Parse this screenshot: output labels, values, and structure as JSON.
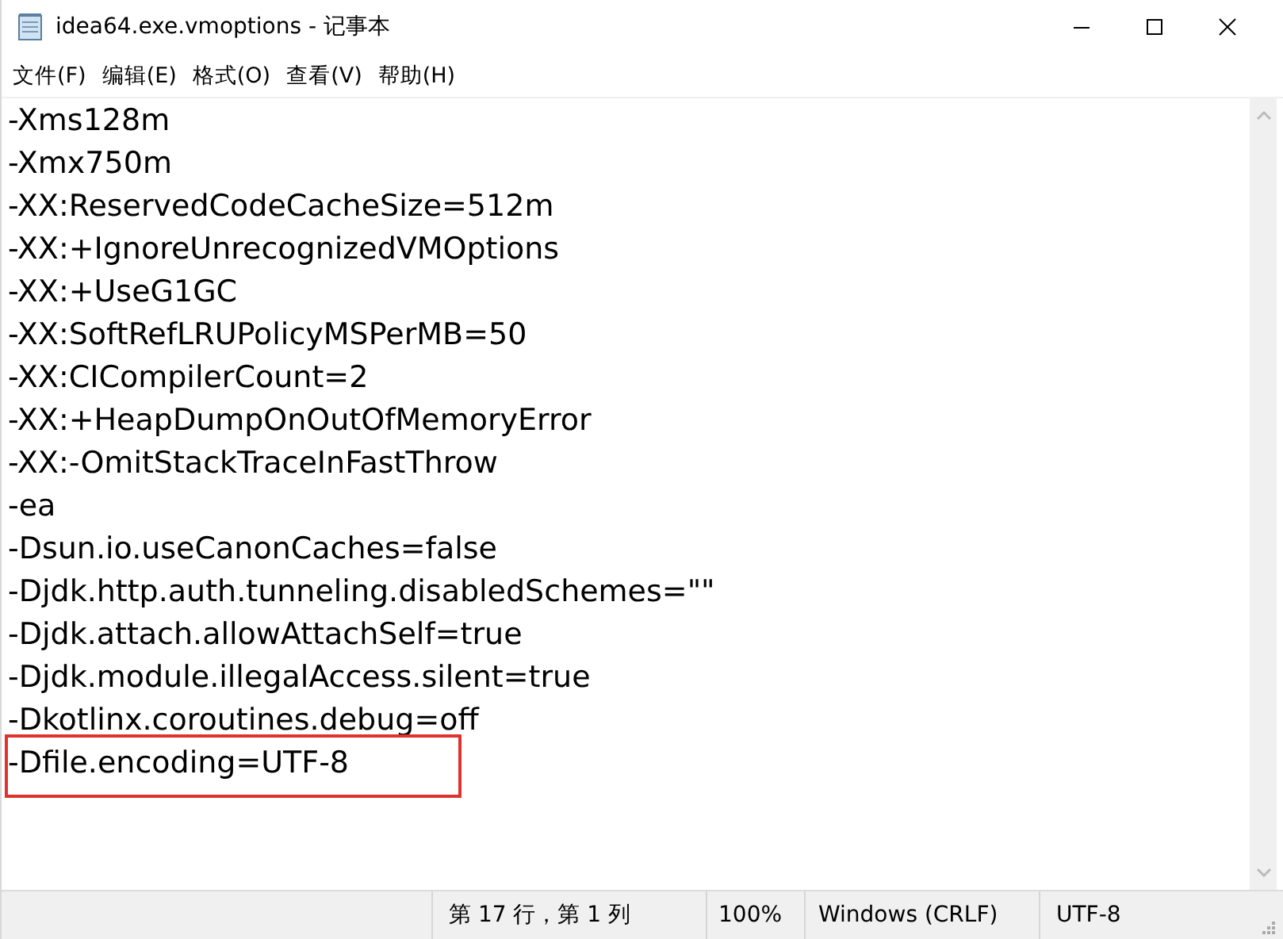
{
  "window": {
    "title": "idea64.exe.vmoptions - 记事本"
  },
  "menu": [
    "文件(F)",
    "编辑(E)",
    "格式(O)",
    "查看(V)",
    "帮助(H)"
  ],
  "lines": [
    {
      "text": "-Xms128m",
      "highlighted": false
    },
    {
      "text": "-Xmx750m",
      "highlighted": false
    },
    {
      "text": "-XX:ReservedCodeCacheSize=512m",
      "highlighted": false
    },
    {
      "text": "-XX:+IgnoreUnrecognizedVMOptions",
      "highlighted": false
    },
    {
      "text": "-XX:+UseG1GC",
      "highlighted": false
    },
    {
      "text": "-XX:SoftRefLRUPolicyMSPerMB=50",
      "highlighted": false
    },
    {
      "text": "-XX:CICompilerCount=2",
      "highlighted": false
    },
    {
      "text": "-XX:+HeapDumpOnOutOfMemoryError",
      "highlighted": false
    },
    {
      "text": "-XX:-OmitStackTraceInFastThrow",
      "highlighted": false
    },
    {
      "text": "-ea",
      "highlighted": false
    },
    {
      "text": "-Dsun.io.useCanonCaches=false",
      "highlighted": false
    },
    {
      "text": "-Djdk.http.auth.tunneling.disabledSchemes=\"\"",
      "highlighted": false
    },
    {
      "text": "-Djdk.attach.allowAttachSelf=true",
      "highlighted": false
    },
    {
      "text": "-Djdk.module.illegalAccess.silent=true",
      "highlighted": false
    },
    {
      "text": "-Dkotlinx.coroutines.debug=off",
      "highlighted": false
    },
    {
      "text": "-Dfile.encoding=UTF-8",
      "highlighted": true
    }
  ],
  "status_bar": [
    "第 17 行，第 1 列",
    "100%",
    "Windows (CRLF)",
    "UTF-8"
  ]
}
